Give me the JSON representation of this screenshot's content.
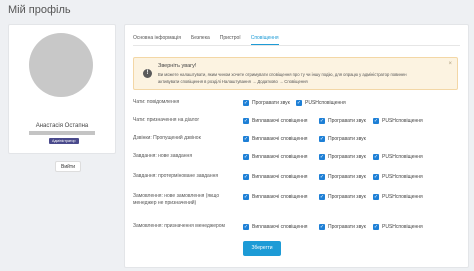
{
  "page": {
    "title": "Мій профіль"
  },
  "profile": {
    "name": "Анастасія Остапна",
    "role": "Адміністратор",
    "logout_label": "Вийти"
  },
  "tabs": [
    {
      "label": "Основна інформація",
      "active": false
    },
    {
      "label": "Безпека",
      "active": false
    },
    {
      "label": "Пристрої",
      "active": false
    },
    {
      "label": "Сповіщення",
      "active": true
    }
  ],
  "alert": {
    "title": "Зверніть увагу!",
    "line1": "Ви можете налаштувати, яким чином хочете отримувати сповіщення про ту чи іншу подію, для опрацю у адміністратор повинен",
    "line2": "активувати сповіщення в розділі Налаштування → Додатково → Сповіщення",
    "close": "×",
    "icon": "exclamation-icon"
  },
  "rows": [
    {
      "label": "Чати: повідомлення",
      "options": [
        {
          "label": "Програвати звук",
          "checked": true
        },
        {
          "label": "PUSHсповіщення",
          "checked": true
        }
      ]
    },
    {
      "label": "Чати: призначення на діалог",
      "options": [
        {
          "label": "Виплаваючі сповіщення",
          "checked": true
        },
        {
          "label": "Програвати звук",
          "checked": true
        },
        {
          "label": "PUSHсповіщення",
          "checked": true
        }
      ]
    },
    {
      "label": "Дзвінки: Пропущений дзвінок",
      "options": [
        {
          "label": "Виплаваючі сповіщення",
          "checked": true
        },
        {
          "label": "Програвати звук",
          "checked": true
        }
      ]
    },
    {
      "label": "Завдання: нове завдання",
      "options": [
        {
          "label": "Виплаваючі сповіщення",
          "checked": true
        },
        {
          "label": "Програвати звук",
          "checked": true
        },
        {
          "label": "PUSHсповіщення",
          "checked": true
        }
      ]
    },
    {
      "label": "Завдання: протерміноване завдання",
      "options": [
        {
          "label": "Виплаваючі сповіщення",
          "checked": true
        },
        {
          "label": "Програвати звук",
          "checked": true
        },
        {
          "label": "PUSHсповіщення",
          "checked": true
        }
      ]
    },
    {
      "label": "Замовлення: нове замовлення (якщо менеджер не призначений)",
      "options": [
        {
          "label": "Виплаваючі сповіщення",
          "checked": true
        },
        {
          "label": "Програвати звук",
          "checked": true
        },
        {
          "label": "PUSHсповіщення",
          "checked": true
        }
      ]
    },
    {
      "label": "Замовлення: призначення менеджером",
      "options": [
        {
          "label": "Виплаваючі сповіщення",
          "checked": true
        },
        {
          "label": "Програвати звук",
          "checked": true
        },
        {
          "label": "PUSHсповіщення",
          "checked": true
        }
      ]
    }
  ],
  "save_label": "Зберегти",
  "colors": {
    "accent": "#1d9bd6",
    "checkbox": "#1d7fd6",
    "alert_bg": "#fcf3e1",
    "badge": "#4a4a8c"
  }
}
